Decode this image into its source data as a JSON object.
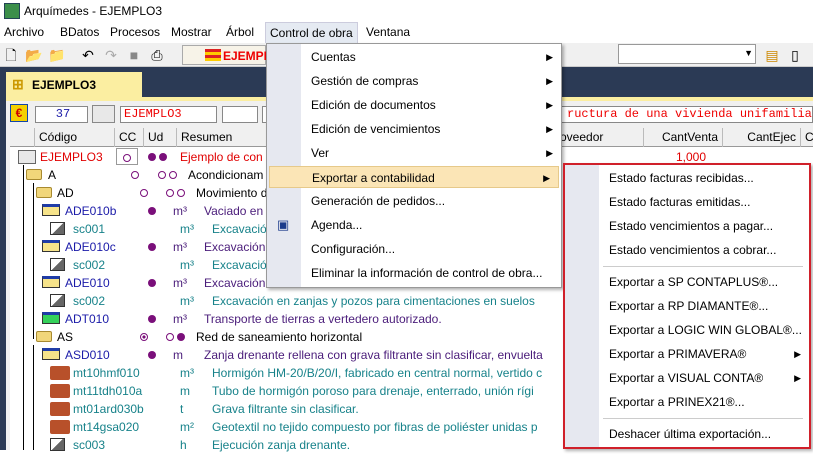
{
  "window": {
    "title": "Arquímedes - EJEMPLO3"
  },
  "menubar": [
    "Archivo",
    "BDatos",
    "Procesos",
    "Mostrar",
    "Árbol",
    "Control de obra",
    "Ventana"
  ],
  "toolbar": {
    "project": "EJEMPL"
  },
  "tab": {
    "label": "EJEMPLO3"
  },
  "fields": {
    "number": "37",
    "code": "EJEMPLO3",
    "blank": "",
    "summary": "ructura de una vivienda unifamiliar"
  },
  "headers": [
    "Código",
    "CC",
    "Ud",
    "Resumen",
    "oveedor",
    "CantVenta",
    "CantEjec",
    "Ca"
  ],
  "rows": [
    {
      "code": "EJEMPLO3",
      "ud": "",
      "res": "Ejemplo de con",
      "cant": "1,000"
    },
    {
      "code": "A",
      "ud": "",
      "res": "Acondicionam"
    },
    {
      "code": "AD",
      "ud": "",
      "res": "Movimiento d"
    },
    {
      "code": "ADE010b",
      "ud": "m³",
      "res": "Vaciado en"
    },
    {
      "code": "sc001",
      "ud": "m³",
      "res": "Excavació"
    },
    {
      "code": "ADE010c",
      "ud": "m³",
      "res": "Excavación"
    },
    {
      "code": "sc002",
      "ud": "m³",
      "res": "Excavació"
    },
    {
      "code": "ADE010",
      "ud": "m³",
      "res": "Excavación"
    },
    {
      "code": "sc002",
      "ud": "m³",
      "res": "Excavación en zanjas y pozos para cimentaciones en suelos"
    },
    {
      "code": "ADT010",
      "ud": "m³",
      "res": "Transporte de tierras a vertedero autorizado."
    },
    {
      "code": "AS",
      "ud": "",
      "res": "Red de saneamiento horizontal"
    },
    {
      "code": "ASD010",
      "ud": "m",
      "res": "Zanja drenante rellena con grava filtrante sin clasificar, envuelta"
    },
    {
      "code": "mt10hmf010",
      "ud": "m³",
      "res": "Hormigón HM-20/B/20/I, fabricado en central normal, vertido c"
    },
    {
      "code": "mt11tdh010a",
      "ud": "m",
      "res": "Tubo de hormigón poroso para drenaje, enterrado, unión rígi"
    },
    {
      "code": "mt01ard030b",
      "ud": "t",
      "res": "Grava filtrante sin clasificar."
    },
    {
      "code": "mt14gsa020",
      "ud": "m²",
      "res": "Geotextil no tejido compuesto por fibras de poliéster unidas p"
    },
    {
      "code": "sc003",
      "ud": "h",
      "res": "Ejecución zanja drenante."
    }
  ],
  "menu": [
    "Cuentas",
    "Gestión de compras",
    "Edición de documentos",
    "Edición de vencimientos",
    "Ver",
    "Exportar a contabilidad",
    "Generación de pedidos...",
    "Agenda...",
    "Configuración...",
    "Eliminar la información de control de obra..."
  ],
  "submenu": [
    "Estado facturas recibidas...",
    "Estado facturas emitidas...",
    "Estado vencimientos a pagar...",
    "Estado vencimientos a cobrar...",
    "Exportar a SP CONTAPLUS®...",
    "Exportar a RP DIAMANTE®...",
    "Exportar a LOGIC WIN GLOBAL®...",
    "Exportar a PRIMAVERA®",
    "Exportar a VISUAL CONTA®",
    "Exportar a PRINEX21®...",
    "Deshacer última exportación..."
  ],
  "colors": {
    "highlight_border": "#d0202a",
    "navy": "#2b3a55",
    "tab": "#fbeea1"
  }
}
